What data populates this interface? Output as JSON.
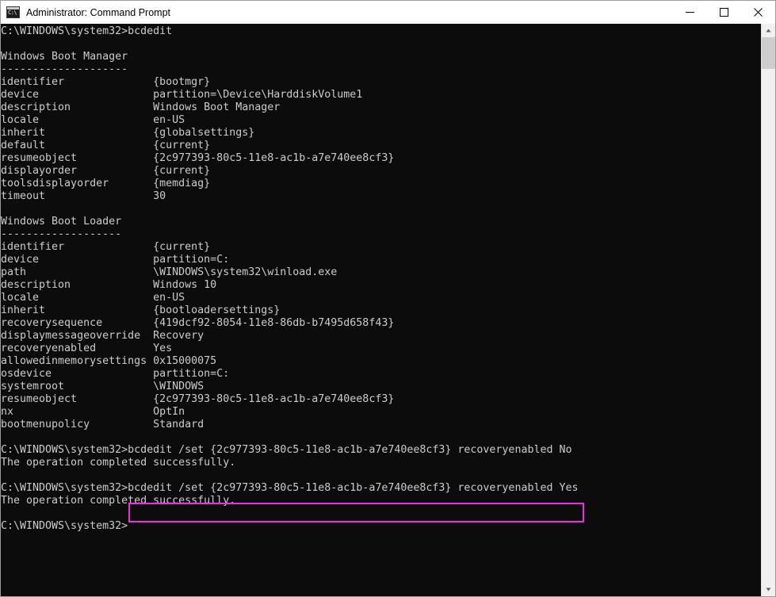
{
  "window": {
    "title": "Administrator: Command Prompt",
    "icon": "console-icon",
    "icon_glyph": "C:\\",
    "minimize_label": "Minimize",
    "maximize_label": "Maximize",
    "close_label": "Close"
  },
  "colors": {
    "console_background": "#0c0c0c",
    "console_text": "#cccccc",
    "highlight_border": "#ee2ee6",
    "titlebar_background": "#ffffff",
    "scrollbar_track": "#f0f0f0",
    "scrollbar_thumb": "#cdcdcd"
  },
  "console": {
    "lines": [
      "C:\\WINDOWS\\system32>bcdedit",
      "",
      "Windows Boot Manager",
      "--------------------",
      "identifier              {bootmgr}",
      "device                  partition=\\Device\\HarddiskVolume1",
      "description             Windows Boot Manager",
      "locale                  en-US",
      "inherit                 {globalsettings}",
      "default                 {current}",
      "resumeobject            {2c977393-80c5-11e8-ac1b-a7e740ee8cf3}",
      "displayorder            {current}",
      "toolsdisplayorder       {memdiag}",
      "timeout                 30",
      "",
      "Windows Boot Loader",
      "-------------------",
      "identifier              {current}",
      "device                  partition=C:",
      "path                    \\WINDOWS\\system32\\winload.exe",
      "description             Windows 10",
      "locale                  en-US",
      "inherit                 {bootloadersettings}",
      "recoverysequence        {419dcf92-8054-11e8-86db-b7495d658f43}",
      "displaymessageoverride  Recovery",
      "recoveryenabled         Yes",
      "allowedinmemorysettings 0x15000075",
      "osdevice                partition=C:",
      "systemroot              \\WINDOWS",
      "resumeobject            {2c977393-80c5-11e8-ac1b-a7e740ee8cf3}",
      "nx                      OptIn",
      "bootmenupolicy          Standard",
      "",
      "C:\\WINDOWS\\system32>bcdedit /set {2c977393-80c5-11e8-ac1b-a7e740ee8cf3} recoveryenabled No",
      "The operation completed successfully.",
      "",
      "C:\\WINDOWS\\system32>bcdedit /set {2c977393-80c5-11e8-ac1b-a7e740ee8cf3} recoveryenabled Yes",
      "The operation completed successfully.",
      "",
      "C:\\WINDOWS\\system32>"
    ],
    "highlighted_command": "bcdedit /set {2c977393-80c5-11e8-ac1b-a7e740ee8cf3} recoveryenabled Yes"
  },
  "scrollbar": {
    "up_arrow": "scroll-up-icon",
    "down_arrow": "scroll-down-icon"
  }
}
